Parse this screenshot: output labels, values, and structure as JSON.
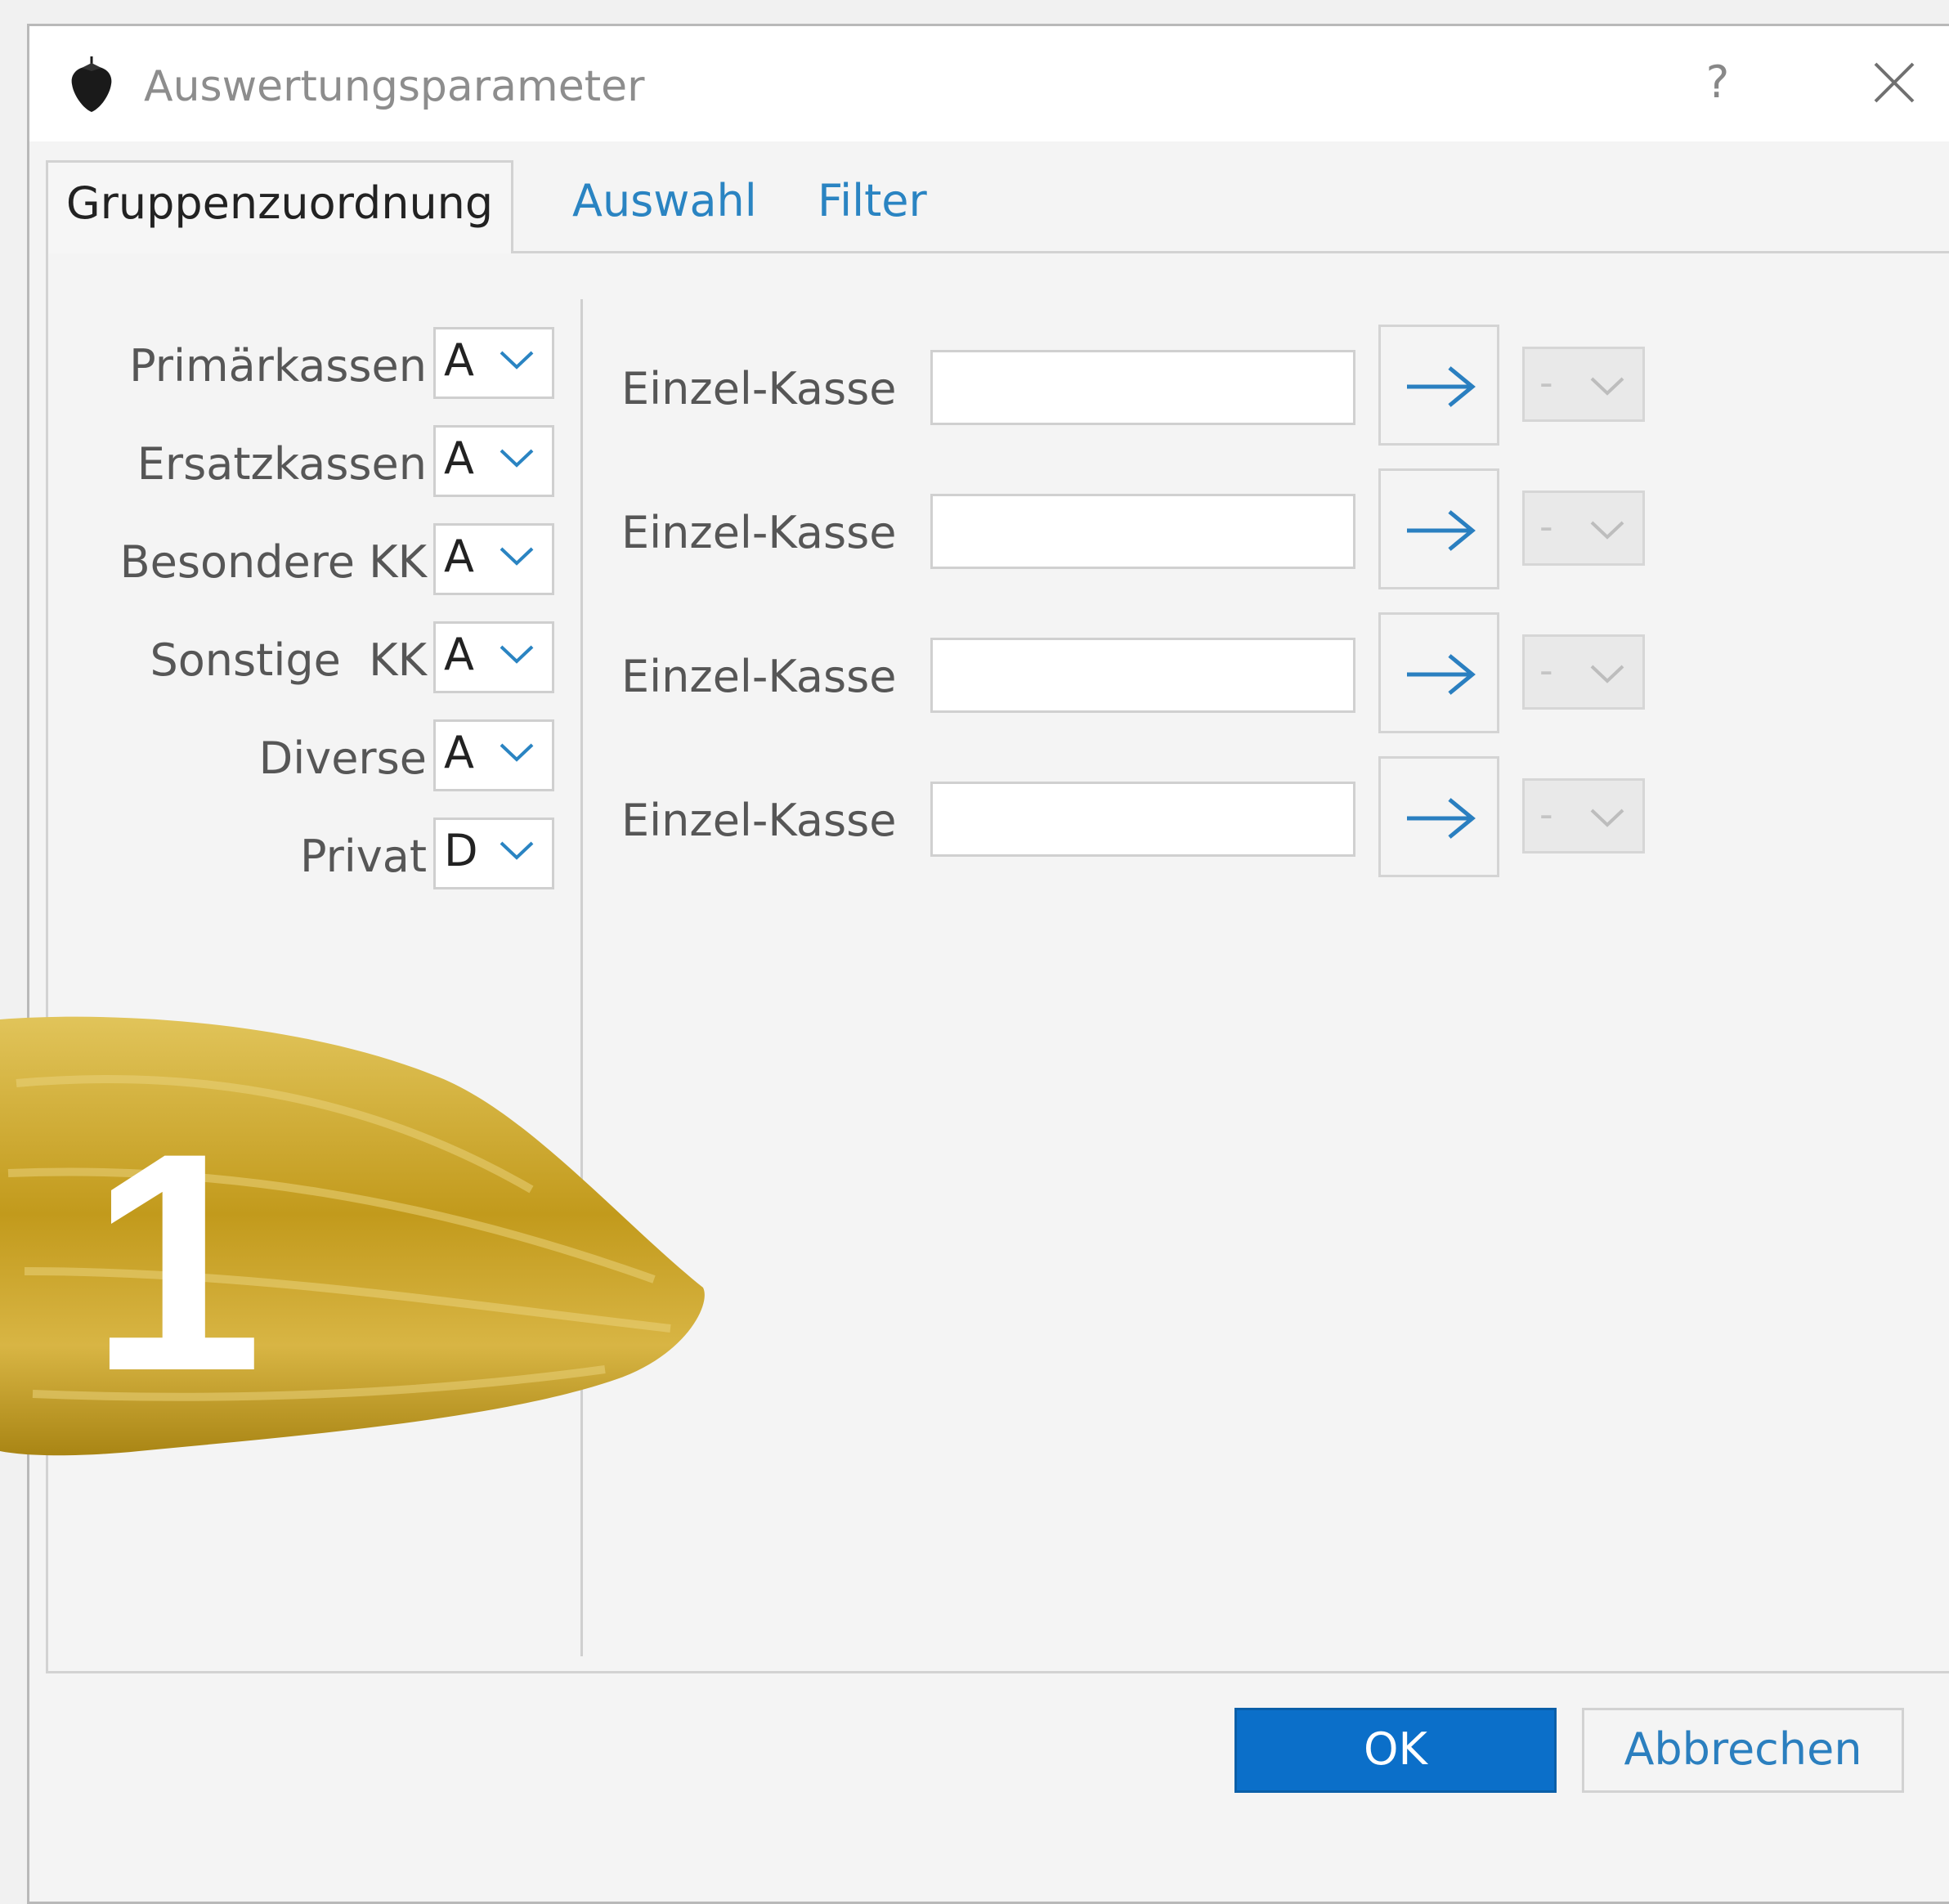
{
  "window": {
    "title": "Auswertungsparameter",
    "help_label": "?"
  },
  "icons": {
    "app": "strawberry-icon",
    "close": "close-icon",
    "arrow": "arrow-right-icon",
    "dropdown": "chevron-down-icon"
  },
  "tabs": [
    {
      "label": "Gruppenzuordnung",
      "active": true
    },
    {
      "label": "Auswahl",
      "active": false
    },
    {
      "label": "Filter",
      "active": false
    }
  ],
  "groups": [
    {
      "label": "Primärkassen",
      "value": "A"
    },
    {
      "label": "Ersatzkassen",
      "value": "A"
    },
    {
      "label": "Besondere KK",
      "value": "A"
    },
    {
      "label": "Sonstige  KK",
      "value": "A"
    },
    {
      "label": "Diverse",
      "value": "A"
    },
    {
      "label": "Privat",
      "value": "D"
    }
  ],
  "single_rows": [
    {
      "label": "Einzel-Kasse",
      "input_value": "",
      "group_value": "-"
    },
    {
      "label": "Einzel-Kasse",
      "input_value": "",
      "group_value": "-"
    },
    {
      "label": "Einzel-Kasse",
      "input_value": "",
      "group_value": "-"
    },
    {
      "label": "Einzel-Kasse",
      "input_value": "",
      "group_value": "-"
    }
  ],
  "buttons": {
    "ok": "OK",
    "cancel": "Abbrechen"
  },
  "overlay": {
    "badge_number": "1",
    "badge_color": "#c9a320"
  },
  "colors": {
    "accent": "#0b6fc9",
    "link": "#2a84c2"
  }
}
